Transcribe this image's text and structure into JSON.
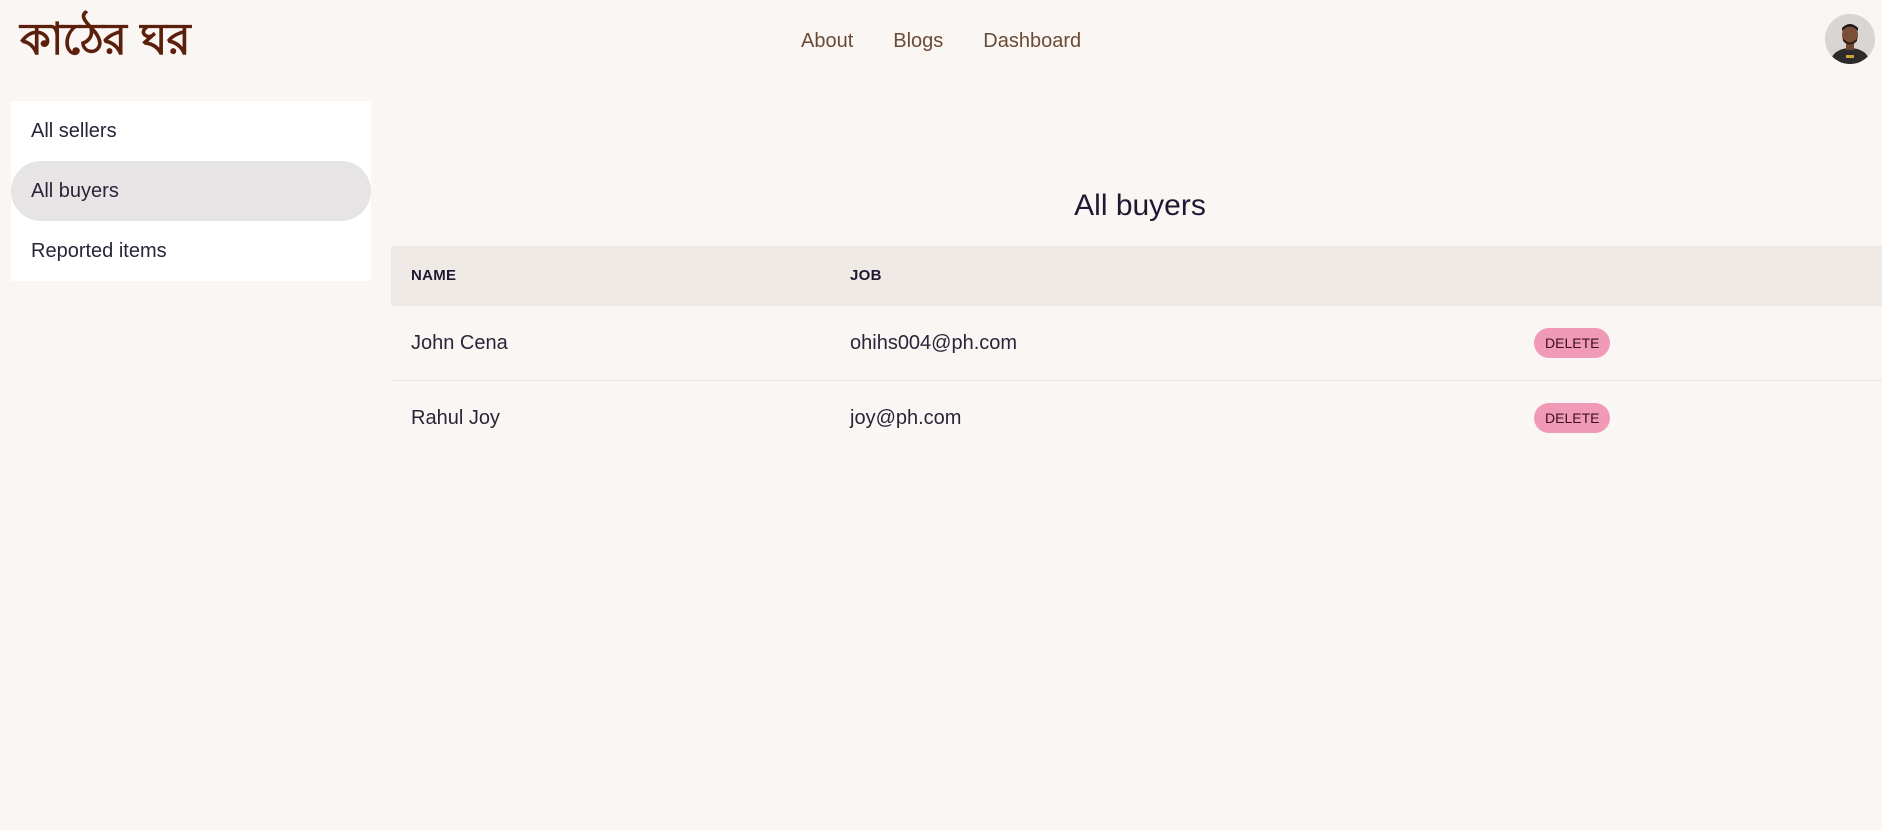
{
  "app": {
    "logo_text": "কাঠের ঘর"
  },
  "nav": {
    "links": [
      {
        "label": "About"
      },
      {
        "label": "Blogs"
      },
      {
        "label": "Dashboard"
      }
    ],
    "avatar_icon": "user-avatar-icon"
  },
  "sidebar": {
    "items": [
      {
        "label": "All sellers",
        "active": false
      },
      {
        "label": "All buyers",
        "active": true
      },
      {
        "label": "Reported items",
        "active": false
      }
    ]
  },
  "main": {
    "title": "All buyers",
    "table": {
      "columns": [
        "NAME",
        "JOB",
        ""
      ],
      "rows": [
        {
          "name": "John Cena",
          "job": "ohihs004@ph.com",
          "action": "DELETE"
        },
        {
          "name": "Rahul Joy",
          "job": "joy@ph.com",
          "action": "DELETE"
        }
      ]
    }
  },
  "colors": {
    "background": "#faf6f4",
    "brand": "#5b1f0b",
    "nav_link": "#6b4a34",
    "delete_button": "#f09ab8",
    "table_header": "#efeae6",
    "active_sidebar": "#e7e4e6"
  }
}
